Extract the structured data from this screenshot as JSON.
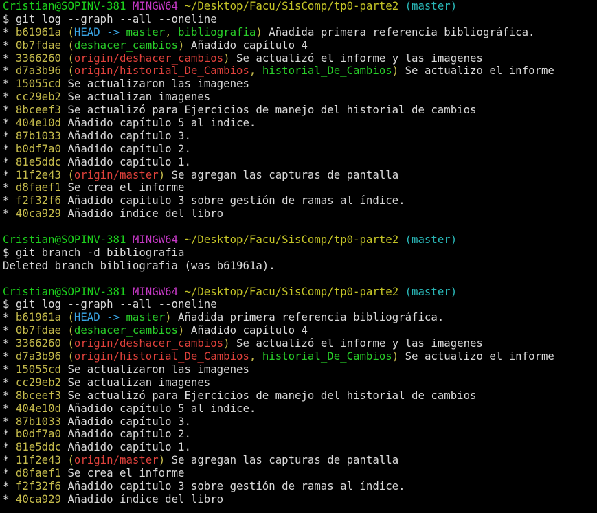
{
  "colors": {
    "default": "#d9d9d9",
    "green": "#1cd11c",
    "magenta": "#c639c6",
    "path": "#c5c527",
    "cyan": "#29b6b6",
    "yellow": "#c5bb4c",
    "head": "#3aa6e6",
    "branch": "#29cf29",
    "remote": "#e0413b"
  },
  "lines": [
    [
      {
        "t": "Cristian@SOPINV-381 ",
        "c": "green"
      },
      {
        "t": "MINGW64 ",
        "c": "magenta"
      },
      {
        "t": "~/Desktop/Facu/SisComp/tp0-parte2 ",
        "c": "path"
      },
      {
        "t": "(master)",
        "c": "cyan"
      }
    ],
    [
      {
        "t": "$ git log --graph --all --oneline",
        "c": "default"
      }
    ],
    [
      {
        "t": "* ",
        "c": "default"
      },
      {
        "t": "b61961a ",
        "c": "yellow"
      },
      {
        "t": "(",
        "c": "yellow"
      },
      {
        "t": "HEAD -> ",
        "c": "head"
      },
      {
        "t": "master",
        "c": "branch"
      },
      {
        "t": ", ",
        "c": "yellow"
      },
      {
        "t": "bibliografia",
        "c": "branch"
      },
      {
        "t": ")",
        "c": "yellow"
      },
      {
        "t": " Añadida primera referencia bibliográfica.",
        "c": "default"
      }
    ],
    [
      {
        "t": "* ",
        "c": "default"
      },
      {
        "t": "0b7fdae ",
        "c": "yellow"
      },
      {
        "t": "(",
        "c": "yellow"
      },
      {
        "t": "deshacer_cambios",
        "c": "branch"
      },
      {
        "t": ")",
        "c": "yellow"
      },
      {
        "t": " Añadido capítulo 4",
        "c": "default"
      }
    ],
    [
      {
        "t": "* ",
        "c": "default"
      },
      {
        "t": "3366260 ",
        "c": "yellow"
      },
      {
        "t": "(",
        "c": "yellow"
      },
      {
        "t": "origin/deshacer_cambios",
        "c": "remote"
      },
      {
        "t": ")",
        "c": "yellow"
      },
      {
        "t": " Se actualizó el informe y las imagenes",
        "c": "default"
      }
    ],
    [
      {
        "t": "* ",
        "c": "default"
      },
      {
        "t": "d7a3b96 ",
        "c": "yellow"
      },
      {
        "t": "(",
        "c": "yellow"
      },
      {
        "t": "origin/historial_De_Cambios",
        "c": "remote"
      },
      {
        "t": ", ",
        "c": "yellow"
      },
      {
        "t": "historial_De_Cambios",
        "c": "branch"
      },
      {
        "t": ")",
        "c": "yellow"
      },
      {
        "t": " Se actualizo el informe",
        "c": "default"
      }
    ],
    [
      {
        "t": "* ",
        "c": "default"
      },
      {
        "t": "15055cd ",
        "c": "yellow"
      },
      {
        "t": "Se actualizaron las imagenes",
        "c": "default"
      }
    ],
    [
      {
        "t": "* ",
        "c": "default"
      },
      {
        "t": "cc29eb2 ",
        "c": "yellow"
      },
      {
        "t": "Se actualizan imagenes",
        "c": "default"
      }
    ],
    [
      {
        "t": "* ",
        "c": "default"
      },
      {
        "t": "8bceef3 ",
        "c": "yellow"
      },
      {
        "t": "Se actualizó para Ejercicios de manejo del historial de cambios",
        "c": "default"
      }
    ],
    [
      {
        "t": "* ",
        "c": "default"
      },
      {
        "t": "404e10d ",
        "c": "yellow"
      },
      {
        "t": "Añadido capítulo 5 al indice.",
        "c": "default"
      }
    ],
    [
      {
        "t": "* ",
        "c": "default"
      },
      {
        "t": "87b1033 ",
        "c": "yellow"
      },
      {
        "t": "Añadido capítulo 3.",
        "c": "default"
      }
    ],
    [
      {
        "t": "* ",
        "c": "default"
      },
      {
        "t": "b0df7a0 ",
        "c": "yellow"
      },
      {
        "t": "Añadido capítulo 2.",
        "c": "default"
      }
    ],
    [
      {
        "t": "* ",
        "c": "default"
      },
      {
        "t": "81e5ddc ",
        "c": "yellow"
      },
      {
        "t": "Añadido capítulo 1.",
        "c": "default"
      }
    ],
    [
      {
        "t": "* ",
        "c": "default"
      },
      {
        "t": "11f2e43 ",
        "c": "yellow"
      },
      {
        "t": "(",
        "c": "yellow"
      },
      {
        "t": "origin/master",
        "c": "remote"
      },
      {
        "t": ")",
        "c": "yellow"
      },
      {
        "t": " Se agregan las capturas de pantalla",
        "c": "default"
      }
    ],
    [
      {
        "t": "* ",
        "c": "default"
      },
      {
        "t": "d8faef1 ",
        "c": "yellow"
      },
      {
        "t": "Se crea el informe",
        "c": "default"
      }
    ],
    [
      {
        "t": "* ",
        "c": "default"
      },
      {
        "t": "f2f32f6 ",
        "c": "yellow"
      },
      {
        "t": "Añadido capitulo 3 sobre gestión de ramas al índice.",
        "c": "default"
      }
    ],
    [
      {
        "t": "* ",
        "c": "default"
      },
      {
        "t": "40ca929 ",
        "c": "yellow"
      },
      {
        "t": "Añadido índice del libro",
        "c": "default"
      }
    ],
    [],
    [
      {
        "t": "Cristian@SOPINV-381 ",
        "c": "green"
      },
      {
        "t": "MINGW64 ",
        "c": "magenta"
      },
      {
        "t": "~/Desktop/Facu/SisComp/tp0-parte2 ",
        "c": "path"
      },
      {
        "t": "(master)",
        "c": "cyan"
      }
    ],
    [
      {
        "t": "$ git branch -d bibliografia",
        "c": "default"
      }
    ],
    [
      {
        "t": "Deleted branch bibliografia (was b61961a).",
        "c": "default"
      }
    ],
    [],
    [
      {
        "t": "Cristian@SOPINV-381 ",
        "c": "green"
      },
      {
        "t": "MINGW64 ",
        "c": "magenta"
      },
      {
        "t": "~/Desktop/Facu/SisComp/tp0-parte2 ",
        "c": "path"
      },
      {
        "t": "(master)",
        "c": "cyan"
      }
    ],
    [
      {
        "t": "$ git log --graph --all --oneline",
        "c": "default"
      }
    ],
    [
      {
        "t": "* ",
        "c": "default"
      },
      {
        "t": "b61961a ",
        "c": "yellow"
      },
      {
        "t": "(",
        "c": "yellow"
      },
      {
        "t": "HEAD -> ",
        "c": "head"
      },
      {
        "t": "master",
        "c": "branch"
      },
      {
        "t": ")",
        "c": "yellow"
      },
      {
        "t": " Añadida primera referencia bibliográfica.",
        "c": "default"
      }
    ],
    [
      {
        "t": "* ",
        "c": "default"
      },
      {
        "t": "0b7fdae ",
        "c": "yellow"
      },
      {
        "t": "(",
        "c": "yellow"
      },
      {
        "t": "deshacer_cambios",
        "c": "branch"
      },
      {
        "t": ")",
        "c": "yellow"
      },
      {
        "t": " Añadido capítulo 4",
        "c": "default"
      }
    ],
    [
      {
        "t": "* ",
        "c": "default"
      },
      {
        "t": "3366260 ",
        "c": "yellow"
      },
      {
        "t": "(",
        "c": "yellow"
      },
      {
        "t": "origin/deshacer_cambios",
        "c": "remote"
      },
      {
        "t": ")",
        "c": "yellow"
      },
      {
        "t": " Se actualizó el informe y las imagenes",
        "c": "default"
      }
    ],
    [
      {
        "t": "* ",
        "c": "default"
      },
      {
        "t": "d7a3b96 ",
        "c": "yellow"
      },
      {
        "t": "(",
        "c": "yellow"
      },
      {
        "t": "origin/historial_De_Cambios",
        "c": "remote"
      },
      {
        "t": ", ",
        "c": "yellow"
      },
      {
        "t": "historial_De_Cambios",
        "c": "branch"
      },
      {
        "t": ")",
        "c": "yellow"
      },
      {
        "t": " Se actualizo el informe",
        "c": "default"
      }
    ],
    [
      {
        "t": "* ",
        "c": "default"
      },
      {
        "t": "15055cd ",
        "c": "yellow"
      },
      {
        "t": "Se actualizaron las imagenes",
        "c": "default"
      }
    ],
    [
      {
        "t": "* ",
        "c": "default"
      },
      {
        "t": "cc29eb2 ",
        "c": "yellow"
      },
      {
        "t": "Se actualizan imagenes",
        "c": "default"
      }
    ],
    [
      {
        "t": "* ",
        "c": "default"
      },
      {
        "t": "8bceef3 ",
        "c": "yellow"
      },
      {
        "t": "Se actualizó para Ejercicios de manejo del historial de cambios",
        "c": "default"
      }
    ],
    [
      {
        "t": "* ",
        "c": "default"
      },
      {
        "t": "404e10d ",
        "c": "yellow"
      },
      {
        "t": "Añadido capítulo 5 al indice.",
        "c": "default"
      }
    ],
    [
      {
        "t": "* ",
        "c": "default"
      },
      {
        "t": "87b1033 ",
        "c": "yellow"
      },
      {
        "t": "Añadido capítulo 3.",
        "c": "default"
      }
    ],
    [
      {
        "t": "* ",
        "c": "default"
      },
      {
        "t": "b0df7a0 ",
        "c": "yellow"
      },
      {
        "t": "Añadido capítulo 2.",
        "c": "default"
      }
    ],
    [
      {
        "t": "* ",
        "c": "default"
      },
      {
        "t": "81e5ddc ",
        "c": "yellow"
      },
      {
        "t": "Añadido capítulo 1.",
        "c": "default"
      }
    ],
    [
      {
        "t": "* ",
        "c": "default"
      },
      {
        "t": "11f2e43 ",
        "c": "yellow"
      },
      {
        "t": "(",
        "c": "yellow"
      },
      {
        "t": "origin/master",
        "c": "remote"
      },
      {
        "t": ")",
        "c": "yellow"
      },
      {
        "t": " Se agregan las capturas de pantalla",
        "c": "default"
      }
    ],
    [
      {
        "t": "* ",
        "c": "default"
      },
      {
        "t": "d8faef1 ",
        "c": "yellow"
      },
      {
        "t": "Se crea el informe",
        "c": "default"
      }
    ],
    [
      {
        "t": "* ",
        "c": "default"
      },
      {
        "t": "f2f32f6 ",
        "c": "yellow"
      },
      {
        "t": "Añadido capitulo 3 sobre gestión de ramas al índice.",
        "c": "default"
      }
    ],
    [
      {
        "t": "* ",
        "c": "default"
      },
      {
        "t": "40ca929 ",
        "c": "yellow"
      },
      {
        "t": "Añadido índice del libro",
        "c": "default"
      }
    ]
  ]
}
